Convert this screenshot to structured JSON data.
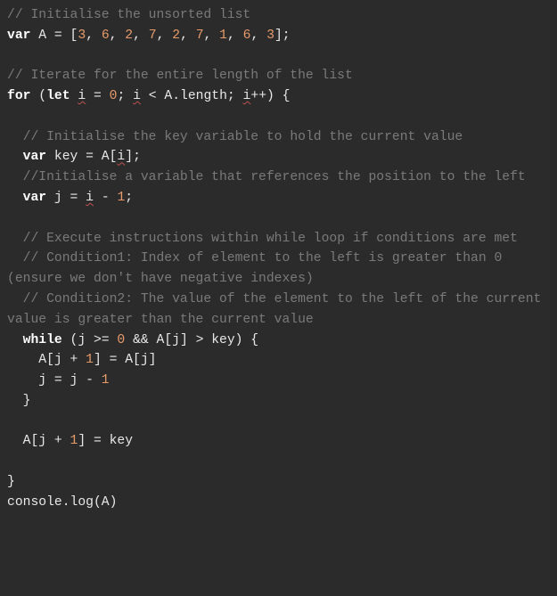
{
  "code": {
    "c1": "// Initialise the unsorted list",
    "l2_var": "var",
    "l2_A": " A ",
    "l2_eq": "= [",
    "l2_n1": "3",
    "l2_s1": ", ",
    "l2_n2": "6",
    "l2_s2": ", ",
    "l2_n3": "2",
    "l2_s3": ", ",
    "l2_n4": "7",
    "l2_s4": ", ",
    "l2_n5": "2",
    "l2_s5": ", ",
    "l2_n6": "7",
    "l2_s6": ", ",
    "l2_n7": "1",
    "l2_s7": ", ",
    "l2_n8": "6",
    "l2_s8": ", ",
    "l2_n9": "3",
    "l2_end": "];",
    "c2": "// Iterate for the entire length of the list",
    "l4_for": "for",
    "l4_open": " (",
    "l4_let": "let",
    "l4_sp1": " ",
    "l4_i1": "i",
    "l4_eq": " = ",
    "l4_zero": "0",
    "l4_semi1": "; ",
    "l4_i2": "i",
    "l4_lt": " < A.length; ",
    "l4_i3": "i",
    "l4_inc": "++) {",
    "c3": "  // Initialise the key variable to hold the current value",
    "l6_ind": "  ",
    "l6_var": "var",
    "l6_key": " key = A[",
    "l6_i": "i",
    "l6_end": "];",
    "c4": "  //Initialise a variable that references the position to the left",
    "l8_ind": "  ",
    "l8_var": "var",
    "l8_j": " j = ",
    "l8_i": "i",
    "l8_m": " - ",
    "l8_one": "1",
    "l8_end": ";",
    "c5": "  // Execute instructions within while loop if conditions are met",
    "c6": "  // Condition1: Index of element to the left is greater than 0 (ensure we don't have negative indexes)",
    "c7": "  // Condition2: The value of the element to the left of the current value is greater than the current value",
    "l12_ind": "  ",
    "l12_while": "while",
    "l12_open": " (j >= ",
    "l12_zero": "0",
    "l12_mid": " && A[j] > key) {",
    "l13_ind": "    A[j + ",
    "l13_one": "1",
    "l13_end": "] = A[j]",
    "l14_ind": "    j = j - ",
    "l14_one": "1",
    "l15": "  }",
    "l17_ind": "  A[j + ",
    "l17_one": "1",
    "l17_end": "] = key",
    "l19": "}",
    "l20a": "console",
    "l20b": ".log(A)"
  }
}
